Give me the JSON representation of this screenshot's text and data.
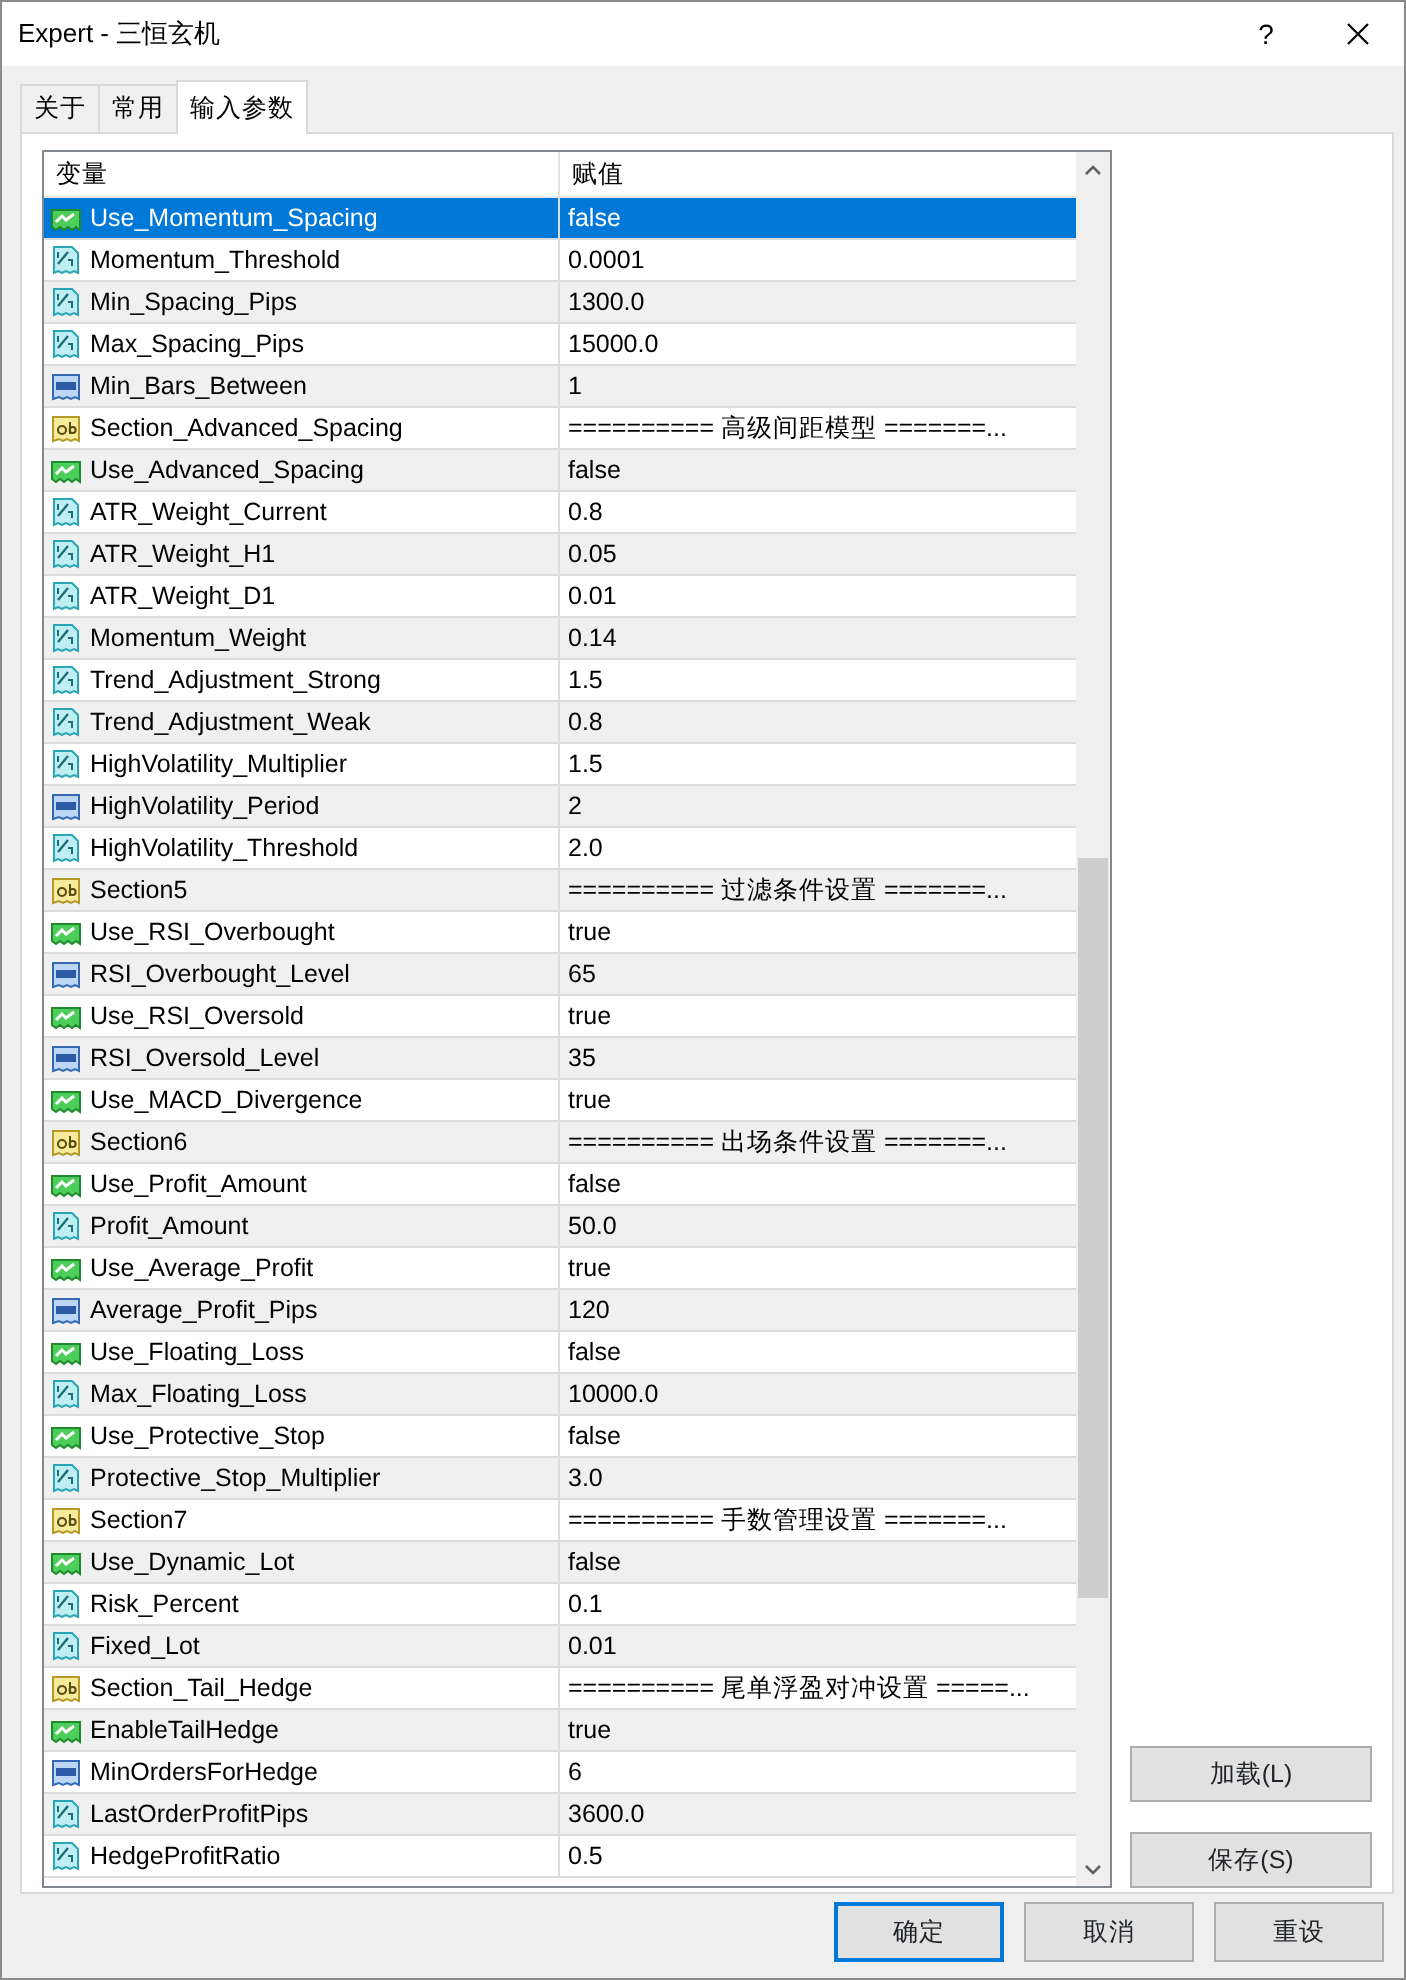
{
  "window": {
    "title": "Expert - 三恒玄机",
    "help": "?"
  },
  "tabs": [
    {
      "label": "关于",
      "selected": false
    },
    {
      "label": "常用",
      "selected": false
    },
    {
      "label": "输入参数",
      "selected": true
    }
  ],
  "table": {
    "columns": [
      "变量",
      "赋值"
    ],
    "rows": [
      {
        "name": "Use_Momentum_Spacing",
        "value": "false",
        "kind": "bool",
        "selected": true
      },
      {
        "name": "Momentum_Threshold",
        "value": "0.0001",
        "kind": "double",
        "selected": false
      },
      {
        "name": "Min_Spacing_Pips",
        "value": "1300.0",
        "kind": "double",
        "selected": false
      },
      {
        "name": "Max_Spacing_Pips",
        "value": "15000.0",
        "kind": "double",
        "selected": false
      },
      {
        "name": "Min_Bars_Between",
        "value": "1",
        "kind": "int",
        "selected": false
      },
      {
        "name": "Section_Advanced_Spacing",
        "value": "========== 高级间距模型 =======...",
        "kind": "string",
        "selected": false
      },
      {
        "name": "Use_Advanced_Spacing",
        "value": "false",
        "kind": "bool",
        "selected": false
      },
      {
        "name": "ATR_Weight_Current",
        "value": "0.8",
        "kind": "double",
        "selected": false
      },
      {
        "name": "ATR_Weight_H1",
        "value": "0.05",
        "kind": "double",
        "selected": false
      },
      {
        "name": "ATR_Weight_D1",
        "value": "0.01",
        "kind": "double",
        "selected": false
      },
      {
        "name": "Momentum_Weight",
        "value": "0.14",
        "kind": "double",
        "selected": false
      },
      {
        "name": "Trend_Adjustment_Strong",
        "value": "1.5",
        "kind": "double",
        "selected": false
      },
      {
        "name": "Trend_Adjustment_Weak",
        "value": "0.8",
        "kind": "double",
        "selected": false
      },
      {
        "name": "HighVolatility_Multiplier",
        "value": "1.5",
        "kind": "double",
        "selected": false
      },
      {
        "name": "HighVolatility_Period",
        "value": "2",
        "kind": "int",
        "selected": false
      },
      {
        "name": "HighVolatility_Threshold",
        "value": "2.0",
        "kind": "double",
        "selected": false
      },
      {
        "name": "Section5",
        "value": "========== 过滤条件设置 =======...",
        "kind": "string",
        "selected": false
      },
      {
        "name": "Use_RSI_Overbought",
        "value": "true",
        "kind": "bool",
        "selected": false
      },
      {
        "name": "RSI_Overbought_Level",
        "value": "65",
        "kind": "int",
        "selected": false
      },
      {
        "name": "Use_RSI_Oversold",
        "value": "true",
        "kind": "bool",
        "selected": false
      },
      {
        "name": "RSI_Oversold_Level",
        "value": "35",
        "kind": "int",
        "selected": false
      },
      {
        "name": "Use_MACD_Divergence",
        "value": "true",
        "kind": "bool",
        "selected": false
      },
      {
        "name": "Section6",
        "value": "========== 出场条件设置 =======...",
        "kind": "string",
        "selected": false
      },
      {
        "name": "Use_Profit_Amount",
        "value": "false",
        "kind": "bool",
        "selected": false
      },
      {
        "name": "Profit_Amount",
        "value": "50.0",
        "kind": "double",
        "selected": false
      },
      {
        "name": "Use_Average_Profit",
        "value": "true",
        "kind": "bool",
        "selected": false
      },
      {
        "name": "Average_Profit_Pips",
        "value": "120",
        "kind": "int",
        "selected": false
      },
      {
        "name": "Use_Floating_Loss",
        "value": "false",
        "kind": "bool",
        "selected": false
      },
      {
        "name": "Max_Floating_Loss",
        "value": "10000.0",
        "kind": "double",
        "selected": false
      },
      {
        "name": "Use_Protective_Stop",
        "value": "false",
        "kind": "bool",
        "selected": false
      },
      {
        "name": "Protective_Stop_Multiplier",
        "value": "3.0",
        "kind": "double",
        "selected": false
      },
      {
        "name": "Section7",
        "value": "========== 手数管理设置 =======...",
        "kind": "string",
        "selected": false
      },
      {
        "name": "Use_Dynamic_Lot",
        "value": "false",
        "kind": "bool",
        "selected": false
      },
      {
        "name": "Risk_Percent",
        "value": "0.1",
        "kind": "double",
        "selected": false
      },
      {
        "name": "Fixed_Lot",
        "value": "0.01",
        "kind": "double",
        "selected": false
      },
      {
        "name": "Section_Tail_Hedge",
        "value": "========== 尾单浮盈对冲设置 =====...",
        "kind": "string",
        "selected": false
      },
      {
        "name": "EnableTailHedge",
        "value": "true",
        "kind": "bool",
        "selected": false
      },
      {
        "name": "MinOrdersForHedge",
        "value": "6",
        "kind": "int",
        "selected": false
      },
      {
        "name": "LastOrderProfitPips",
        "value": "3600.0",
        "kind": "double",
        "selected": false
      },
      {
        "name": "HedgeProfitRatio",
        "value": "0.5",
        "kind": "double",
        "selected": false
      }
    ]
  },
  "side_buttons": [
    "加载(L)",
    "保存(S)"
  ],
  "buttons": [
    {
      "label": "确定",
      "default": true
    },
    {
      "label": "取消",
      "default": false
    },
    {
      "label": "重设",
      "default": false
    }
  ]
}
